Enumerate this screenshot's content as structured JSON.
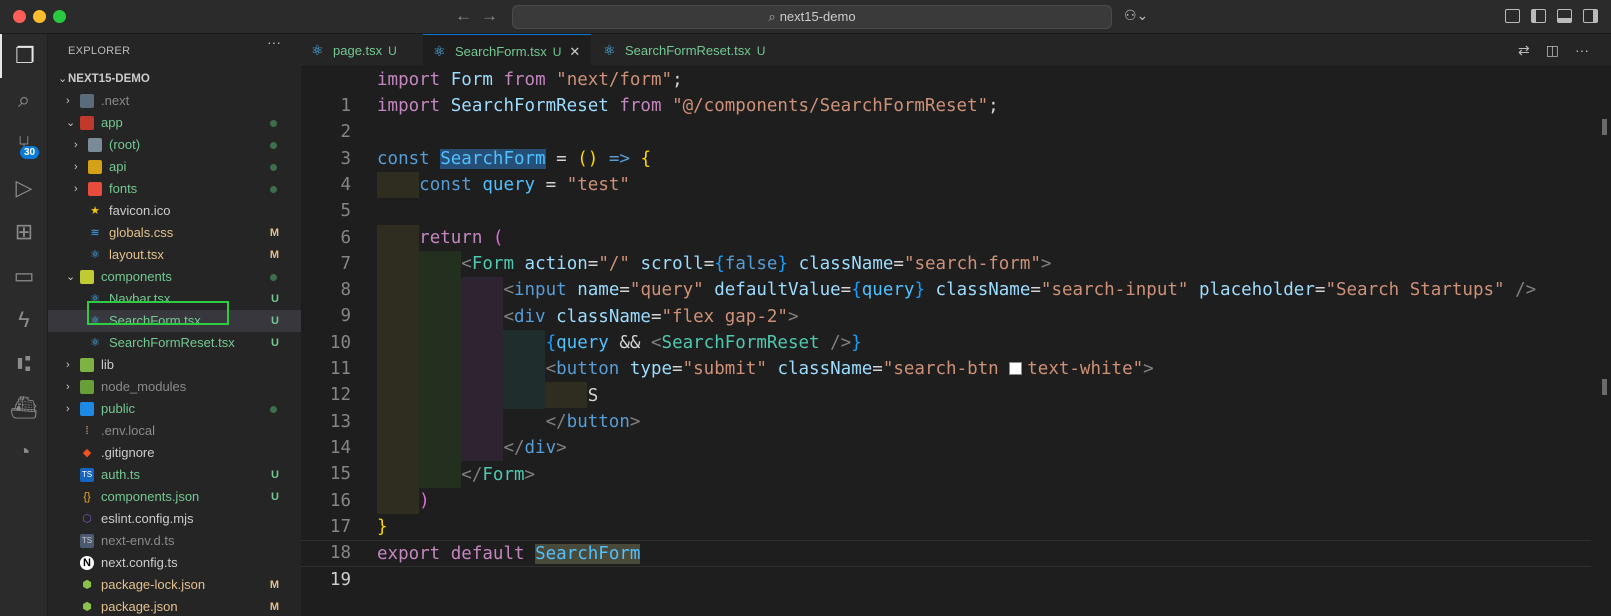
{
  "titlebar": {
    "search_text": "next15-demo",
    "back_icon": "arrow-left-icon",
    "forward_icon": "arrow-right-icon"
  },
  "activity_bar": {
    "items": [
      {
        "name": "explorer",
        "icon": "files-icon"
      },
      {
        "name": "search",
        "icon": "search-icon"
      },
      {
        "name": "source-control",
        "icon": "source-control-icon",
        "badge": "30"
      },
      {
        "name": "run-debug",
        "icon": "debug-icon"
      },
      {
        "name": "extensions",
        "icon": "extensions-icon"
      },
      {
        "name": "remote-explorer",
        "icon": "remote-icon"
      },
      {
        "name": "thunder",
        "icon": "lightning-icon"
      },
      {
        "name": "git-graph",
        "icon": "git-graph-icon"
      },
      {
        "name": "docker",
        "icon": "docker-icon"
      },
      {
        "name": "accounts",
        "icon": "accounts-icon"
      }
    ]
  },
  "sidebar": {
    "title": "EXPLORER",
    "more": "···",
    "root": "NEXT15-DEMO",
    "items": [
      {
        "name": ".next",
        "type": "folder",
        "status": ""
      },
      {
        "name": "app",
        "type": "folder",
        "status": "dot"
      },
      {
        "name": "(root)",
        "type": "folder",
        "status": "dot"
      },
      {
        "name": "api",
        "type": "folder",
        "status": "dot"
      },
      {
        "name": "fonts",
        "type": "folder",
        "status": "dot"
      },
      {
        "name": "favicon.ico",
        "type": "file",
        "status": ""
      },
      {
        "name": "globals.css",
        "type": "file",
        "status": "M"
      },
      {
        "name": "layout.tsx",
        "type": "file",
        "status": "M"
      },
      {
        "name": "components",
        "type": "folder",
        "status": "dot"
      },
      {
        "name": "Navbar.tsx",
        "type": "file",
        "status": "U"
      },
      {
        "name": "SearchForm.tsx",
        "type": "file",
        "status": "U"
      },
      {
        "name": "SearchFormReset.tsx",
        "type": "file",
        "status": "U"
      },
      {
        "name": "lib",
        "type": "folder",
        "status": ""
      },
      {
        "name": "node_modules",
        "type": "folder",
        "status": ""
      },
      {
        "name": "public",
        "type": "folder",
        "status": "dot"
      },
      {
        "name": ".env.local",
        "type": "file",
        "status": ""
      },
      {
        "name": ".gitignore",
        "type": "file",
        "status": ""
      },
      {
        "name": "auth.ts",
        "type": "file",
        "status": "U"
      },
      {
        "name": "components.json",
        "type": "file",
        "status": "U"
      },
      {
        "name": "eslint.config.mjs",
        "type": "file",
        "status": ""
      },
      {
        "name": "next-env.d.ts",
        "type": "file",
        "status": ""
      },
      {
        "name": "next.config.ts",
        "type": "file",
        "status": ""
      },
      {
        "name": "package-lock.json",
        "type": "file",
        "status": "M"
      },
      {
        "name": "package.json",
        "type": "file",
        "status": "M"
      }
    ]
  },
  "tabs": [
    {
      "label": "page.tsx",
      "status": "U",
      "active": false
    },
    {
      "label": "SearchForm.tsx",
      "status": "U",
      "active": true,
      "close": "✕"
    },
    {
      "label": "SearchFormReset.tsx",
      "status": "U",
      "active": false
    }
  ],
  "editor": {
    "line_numbers": [
      "1",
      "2",
      "3",
      "4",
      "5",
      "6",
      "7",
      "8",
      "9",
      "10",
      "11",
      "12",
      "13",
      "14",
      "15",
      "16",
      "17",
      "18",
      "19"
    ],
    "current_line": "19",
    "code": {
      "l1_import": "import",
      "l1_name": "Form",
      "l1_from": "from",
      "l1_src": "\"next/form\"",
      "l2_import": "import",
      "l2_name": "SearchFormReset",
      "l2_from": "from",
      "l2_src": "\"@/components/SearchFormReset\"",
      "l4_const": "const",
      "l4_name": "SearchForm",
      "l5_const": "const",
      "l5_name": "query",
      "l5_val": "\"test\"",
      "l7_return": "return",
      "l8_tag": "Form",
      "l8_action": "\"/\"",
      "l8_scroll": "false",
      "l8_class": "\"search-form\"",
      "l9_tag": "input",
      "l9_name": "\"query\"",
      "l9_default": "query",
      "l9_class": "\"search-input\"",
      "l9_placeholder": "\"Search Startups\"",
      "l10_tag": "div",
      "l10_class": "\"flex gap-2\"",
      "l11_query": "query",
      "l11_comp": "SearchFormReset",
      "l12_tag": "button",
      "l12_type": "\"submit\"",
      "l12_class_a": "\"search-btn ",
      "l12_class_b": "text-white\"",
      "l13_text": "S",
      "l14_tag": "button",
      "l15_tag": "div",
      "l16_tag": "Form",
      "l19_export": "export",
      "l19_default": "default",
      "l19_name": "SearchForm"
    }
  }
}
